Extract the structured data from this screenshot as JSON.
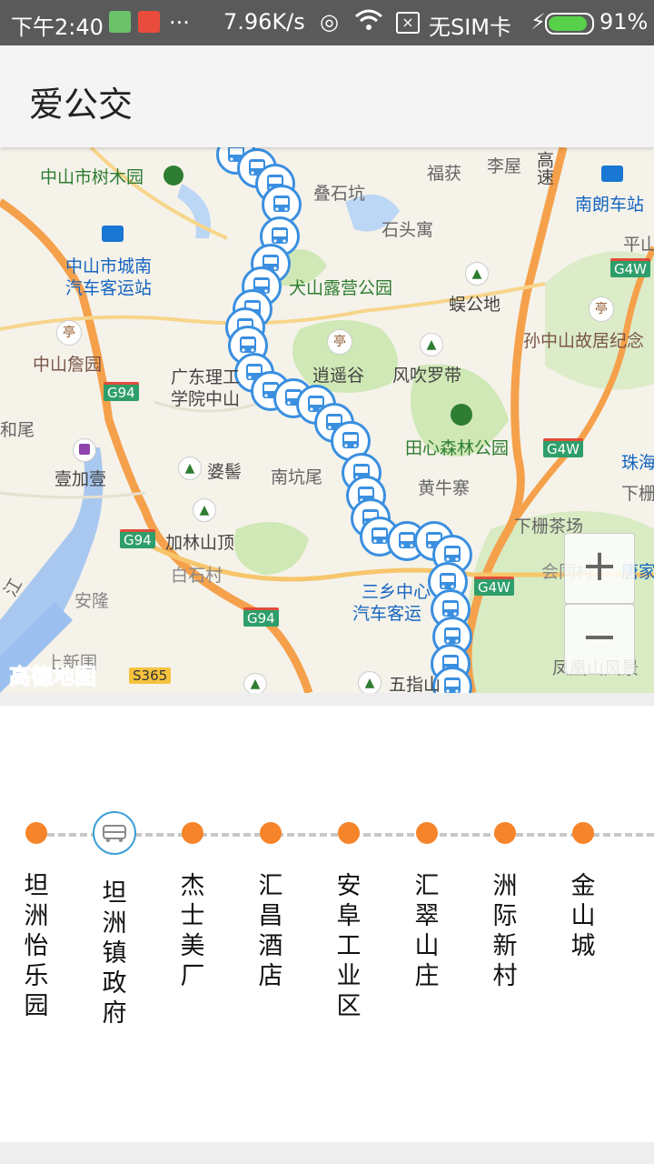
{
  "status_bar": {
    "time": "下午2:40",
    "more": "...",
    "speed": "7.96K/s",
    "sim": "无SIM卡",
    "battery": "91%"
  },
  "app_bar": {
    "title": "爱公交"
  },
  "map": {
    "labels": [
      "中山市树木园",
      "叠石坑",
      "福获",
      "李屋",
      "高速",
      "南朗车站",
      "中山市城南",
      "汽车客运站",
      "石头寓",
      "平山",
      "犬山露营公园",
      "蜈公地",
      "中山詹园",
      "孙中山故居纪念",
      "广东理工",
      "学院中山",
      "逍遥谷",
      "风吹罗带",
      "和尾",
      "田心森林公园",
      "珠海",
      "壹加壹",
      "婆髻",
      "南坑尾",
      "黄牛寨",
      "下栅",
      "加林山顶",
      "下栅茶场",
      "白石村",
      "会同村",
      "唐家",
      "安隆",
      "三乡中心",
      "汽车客运",
      "上新围",
      "五指山",
      "凤凰山风景",
      "江"
    ],
    "road_badges": [
      "G94",
      "G94",
      "G94",
      "G4W",
      "G4W",
      "G4W"
    ],
    "s_road": "S365",
    "watermark": "高德地图",
    "zoom_in": "+",
    "zoom_out": "−"
  },
  "stops": [
    {
      "name": "坦洲怡乐园",
      "current": false
    },
    {
      "name": "坦洲镇政府",
      "current": true
    },
    {
      "name": "杰士美厂",
      "current": false
    },
    {
      "name": "汇昌酒店",
      "current": false
    },
    {
      "name": "安阜工业区",
      "current": false
    },
    {
      "name": "汇翠山庄",
      "current": false
    },
    {
      "name": "洲际新村",
      "current": false
    },
    {
      "name": "金山城",
      "current": false
    }
  ],
  "colors": {
    "accent_orange": "#f5842a",
    "bus_blue": "#3a8fe0",
    "road_orange": "#f5a04a"
  }
}
